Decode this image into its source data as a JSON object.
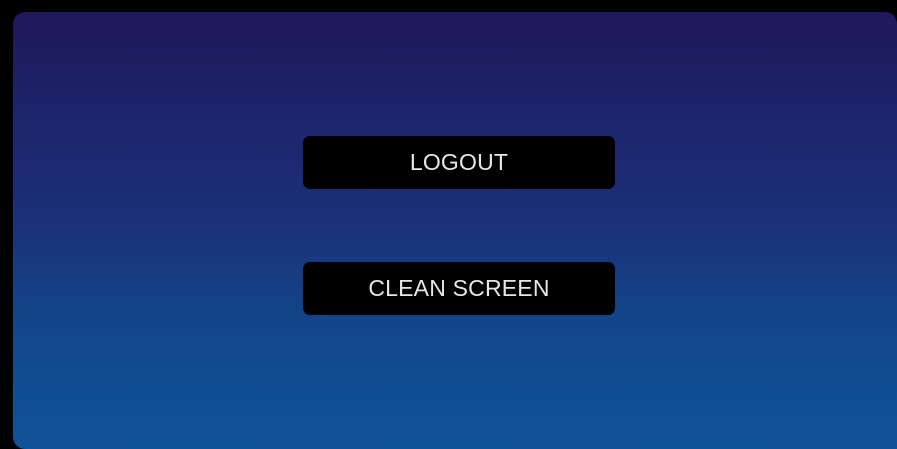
{
  "colors": {
    "outer_background": "#000000",
    "panel_gradient_top": "#1f185c",
    "panel_gradient_bottom": "#0f5399",
    "button_background": "#000000",
    "button_text": "#e6e6e6"
  },
  "actions": {
    "logout_label": "LOGOUT",
    "clean_screen_label": "CLEAN SCREEN"
  }
}
